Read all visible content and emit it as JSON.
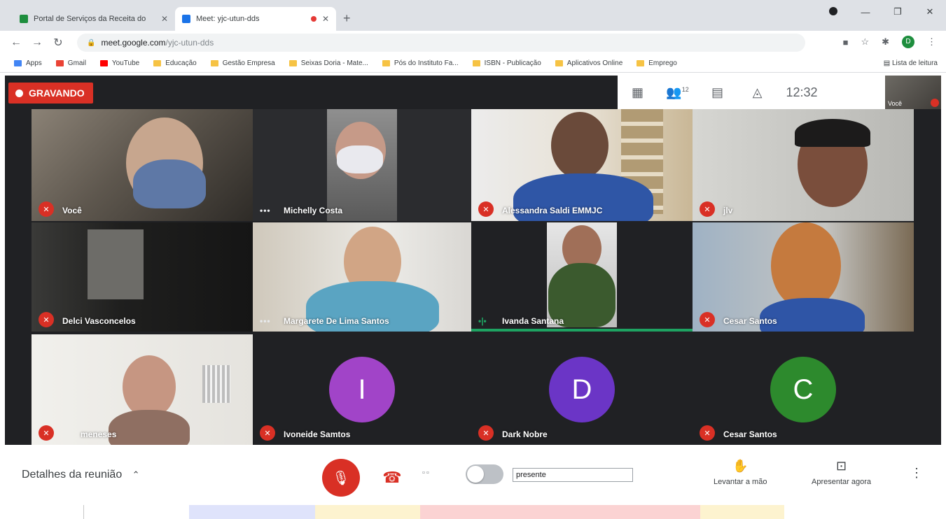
{
  "browser": {
    "tabs": [
      {
        "title": "Portal de Serviços da Receita do",
        "active": false,
        "favicon_color": "#1e8e3e"
      },
      {
        "title": "Meet: yjc-utun-dds",
        "active": true,
        "favicon_color": "#1a73e8"
      }
    ],
    "url_host": "meet.google.com",
    "url_path": "/yjc-utun-dds",
    "profile_initial": "D",
    "bookmarks": [
      {
        "label": "Apps",
        "icon": "apps-grid-icon",
        "color": "#4285f4"
      },
      {
        "label": "Gmail",
        "icon": "gmail-icon",
        "color": "#ea4335"
      },
      {
        "label": "YouTube",
        "icon": "youtube-icon",
        "color": "#ff0000"
      },
      {
        "label": "Educação",
        "icon": "folder-icon",
        "color": "#f6c344"
      },
      {
        "label": "Gestão Empresa",
        "icon": "folder-icon",
        "color": "#f6c344"
      },
      {
        "label": "Seixas Doria - Mate...",
        "icon": "folder-icon",
        "color": "#f6c344"
      },
      {
        "label": "Pós do Instituto Fa...",
        "icon": "folder-icon",
        "color": "#f6c344"
      },
      {
        "label": "ISBN - Publicação",
        "icon": "folder-icon",
        "color": "#f6c344"
      },
      {
        "label": "Aplicativos Online",
        "icon": "folder-icon",
        "color": "#f6c344"
      },
      {
        "label": "Emprego",
        "icon": "folder-icon",
        "color": "#f6c344"
      }
    ],
    "reading_list": "Lista de leitura"
  },
  "meet": {
    "recording_label": "GRAVANDO",
    "participants_count": "12",
    "clock": "12:32",
    "self_label": "Você",
    "tiles": [
      {
        "name": "Você",
        "status": "muted"
      },
      {
        "name": "Michelly Costa",
        "status": "more"
      },
      {
        "name": "Alessandra Saldi EMMJC",
        "status": "muted"
      },
      {
        "name": "jlv",
        "status": "muted"
      },
      {
        "name": "Delci Vasconcelos",
        "status": "muted"
      },
      {
        "name": "Margarete De Lima Santos",
        "status": "more"
      },
      {
        "name": "Ivanda Santana",
        "status": "speaking"
      },
      {
        "name": "Cesar Santos",
        "status": "muted"
      },
      {
        "name": "meneses",
        "status": "muted"
      },
      {
        "name": "Ivoneide Samtos",
        "status": "muted",
        "initial": "I",
        "color": "#a144c8"
      },
      {
        "name": "Dark Nobre",
        "status": "muted",
        "initial": "D",
        "color": "#6b35c6"
      },
      {
        "name": "Cesar Santos",
        "status": "muted",
        "initial": "C",
        "color": "#2d8a2d"
      }
    ]
  },
  "controls": {
    "details_label": "Detalhes da reunião",
    "presente_value": "presente",
    "raise_hand_label": "Levantar a mão",
    "present_label": "Apresentar agora"
  }
}
